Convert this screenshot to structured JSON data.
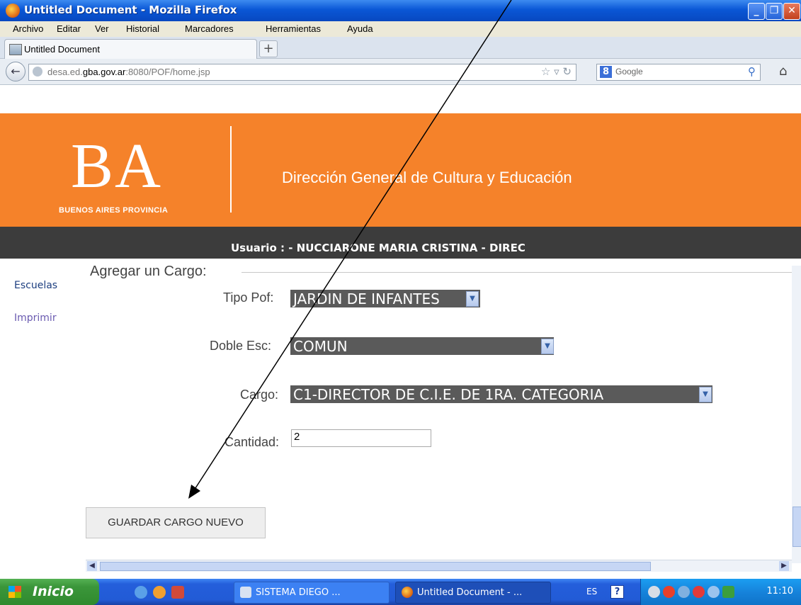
{
  "window": {
    "title": "Untitled Document - Mozilla Firefox"
  },
  "menu": [
    "Archivo",
    "Editar",
    "Ver",
    "Historial",
    "Marcadores",
    "Herramientas",
    "Ayuda"
  ],
  "tab": {
    "title": "Untitled Document",
    "new_tab_symbol": "+"
  },
  "nav": {
    "url_prefix": "desa.ed.",
    "url_domain": "gba.gov.ar",
    "url_suffix": ":8080/POF/home.jsp",
    "search_engine_badge": "8",
    "search_placeholder": "Google"
  },
  "header": {
    "logo": "BA",
    "logo_subtitle": "BUENOS AIRES PROVINCIA",
    "organization": "Dirección General de Cultura y Educación",
    "user_line": "Usuario : - NUCCIARONE MARIA CRISTINA - DIREC"
  },
  "sidebar": {
    "items": [
      "Escuelas",
      "Imprimir"
    ]
  },
  "form": {
    "legend": "Agregar un Cargo:",
    "tipo_pof_label": "Tipo Pof:",
    "tipo_pof_value": "JARDIN DE INFANTES",
    "doble_esc_label": "Doble Esc:",
    "doble_esc_value": "COMUN",
    "cargo_label": "Cargo:",
    "cargo_value": "C1-DIRECTOR DE C.I.E. DE 1RA. CATEGORIA",
    "cantidad_label": "Cantidad:",
    "cantidad_value": "2",
    "save_button": "GUARDAR CARGO NUEVO"
  },
  "taskbar": {
    "start": "Inicio",
    "tasks": [
      "SISTEMA DIEGO ...",
      "Untitled Document - ..."
    ],
    "language": "ES",
    "help": "?",
    "clock": "11:10"
  },
  "colors": {
    "banner": "#f5822a",
    "user_bar": "#3c3c3c",
    "select_bg": "#5a5a5a",
    "taskbar": "#245edb"
  }
}
